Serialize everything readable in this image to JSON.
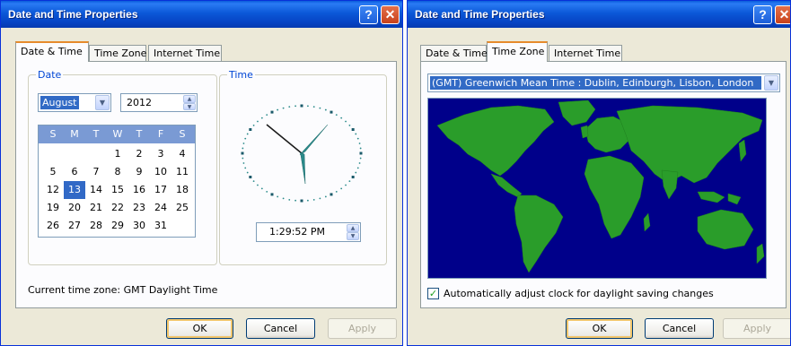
{
  "left_window": {
    "title": "Date and Time Properties",
    "tabs": [
      "Date & Time",
      "Time Zone",
      "Internet Time"
    ],
    "date_group_label": "Date",
    "time_group_label": "Time",
    "month": "August",
    "year": "2012",
    "weekdays": [
      "S",
      "M",
      "T",
      "W",
      "T",
      "F",
      "S"
    ],
    "calendar_rows": [
      [
        "",
        "",
        "",
        "1",
        "2",
        "3",
        "4"
      ],
      [
        "5",
        "6",
        "7",
        "8",
        "9",
        "10",
        "11"
      ],
      [
        "12",
        "13",
        "14",
        "15",
        "16",
        "17",
        "18"
      ],
      [
        "19",
        "20",
        "21",
        "22",
        "23",
        "24",
        "25"
      ],
      [
        "26",
        "27",
        "28",
        "29",
        "30",
        "31",
        ""
      ]
    ],
    "selected_day": "13",
    "time_value": "1:29:52 PM",
    "current_time_zone": "Current time zone:  GMT Daylight Time",
    "ok_label": "OK",
    "cancel_label": "Cancel",
    "apply_label": "Apply"
  },
  "right_window": {
    "title": "Date and Time Properties",
    "tabs": [
      "Date & Time",
      "Time Zone",
      "Internet Time"
    ],
    "timezone_value": "(GMT) Greenwich Mean Time : Dublin, Edinburgh, Lisbon, London",
    "dst_label": "Automatically adjust clock for daylight saving changes",
    "dst_checked": true,
    "ok_label": "OK",
    "cancel_label": "Cancel",
    "apply_label": "Apply"
  },
  "icons": {
    "help": "help-icon",
    "close": "close-icon",
    "dropdown": "chevron-down-icon",
    "spin_up": "spin-up-icon",
    "spin_down": "spin-down-icon",
    "checkbox": "checkmark-icon"
  },
  "colors": {
    "titlebar": "#0a5cdb",
    "dialog_bg": "#ece9d8",
    "map_ocean": "#00008a",
    "map_land": "#2a9d2a",
    "clock_hands": "#2a8a8a",
    "calendar_header": "#7a9ad4",
    "selection": "#316ac5"
  }
}
